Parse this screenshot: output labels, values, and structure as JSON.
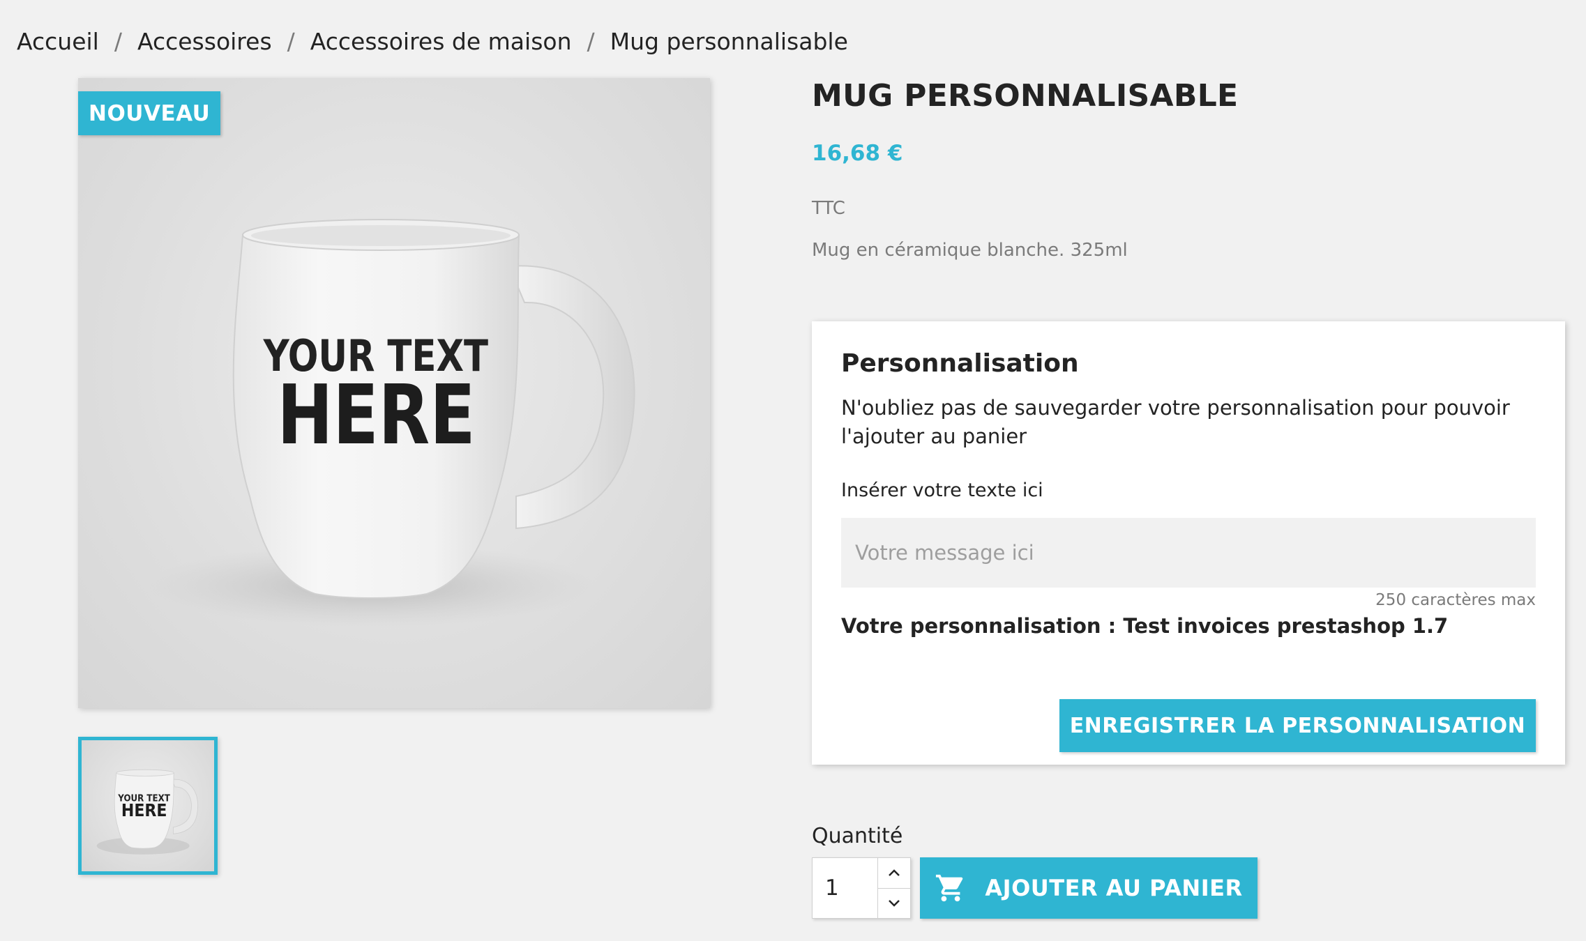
{
  "breadcrumb": {
    "items": [
      "Accueil",
      "Accessoires",
      "Accessoires de maison",
      "Mug personnalisable"
    ],
    "separator": "/"
  },
  "gallery": {
    "badge": "NOUVEAU",
    "mug_text_line1": "YOUR TEXT",
    "mug_text_line2": "HERE"
  },
  "product": {
    "title": "MUG PERSONNALISABLE",
    "price": "16,68 €",
    "tax_label": "TTC",
    "short_description": "Mug en céramique blanche. 325ml"
  },
  "customization": {
    "title": "Personnalisation",
    "note": "N'oubliez pas de sauvegarder votre personnalisation pour pouvoir l'ajouter au panier",
    "field_label": "Insérer votre texte ici",
    "placeholder": "Votre message ici",
    "value": "",
    "max_chars": "250 caractères max",
    "saved_text": "Votre personnalisation : Test invoices prestashop 1.7",
    "save_button": "ENREGISTRER LA PERSONNALISATION"
  },
  "purchase": {
    "quantity_label": "Quantité",
    "quantity_value": "1",
    "add_to_cart": "AJOUTER AU PANIER"
  },
  "colors": {
    "accent": "#2fb5d2",
    "background": "#f1f1f1",
    "text": "#232323",
    "muted": "#7a7a7a"
  },
  "icons": [
    "chevron-up-icon",
    "chevron-down-icon",
    "shopping-cart-icon"
  ]
}
